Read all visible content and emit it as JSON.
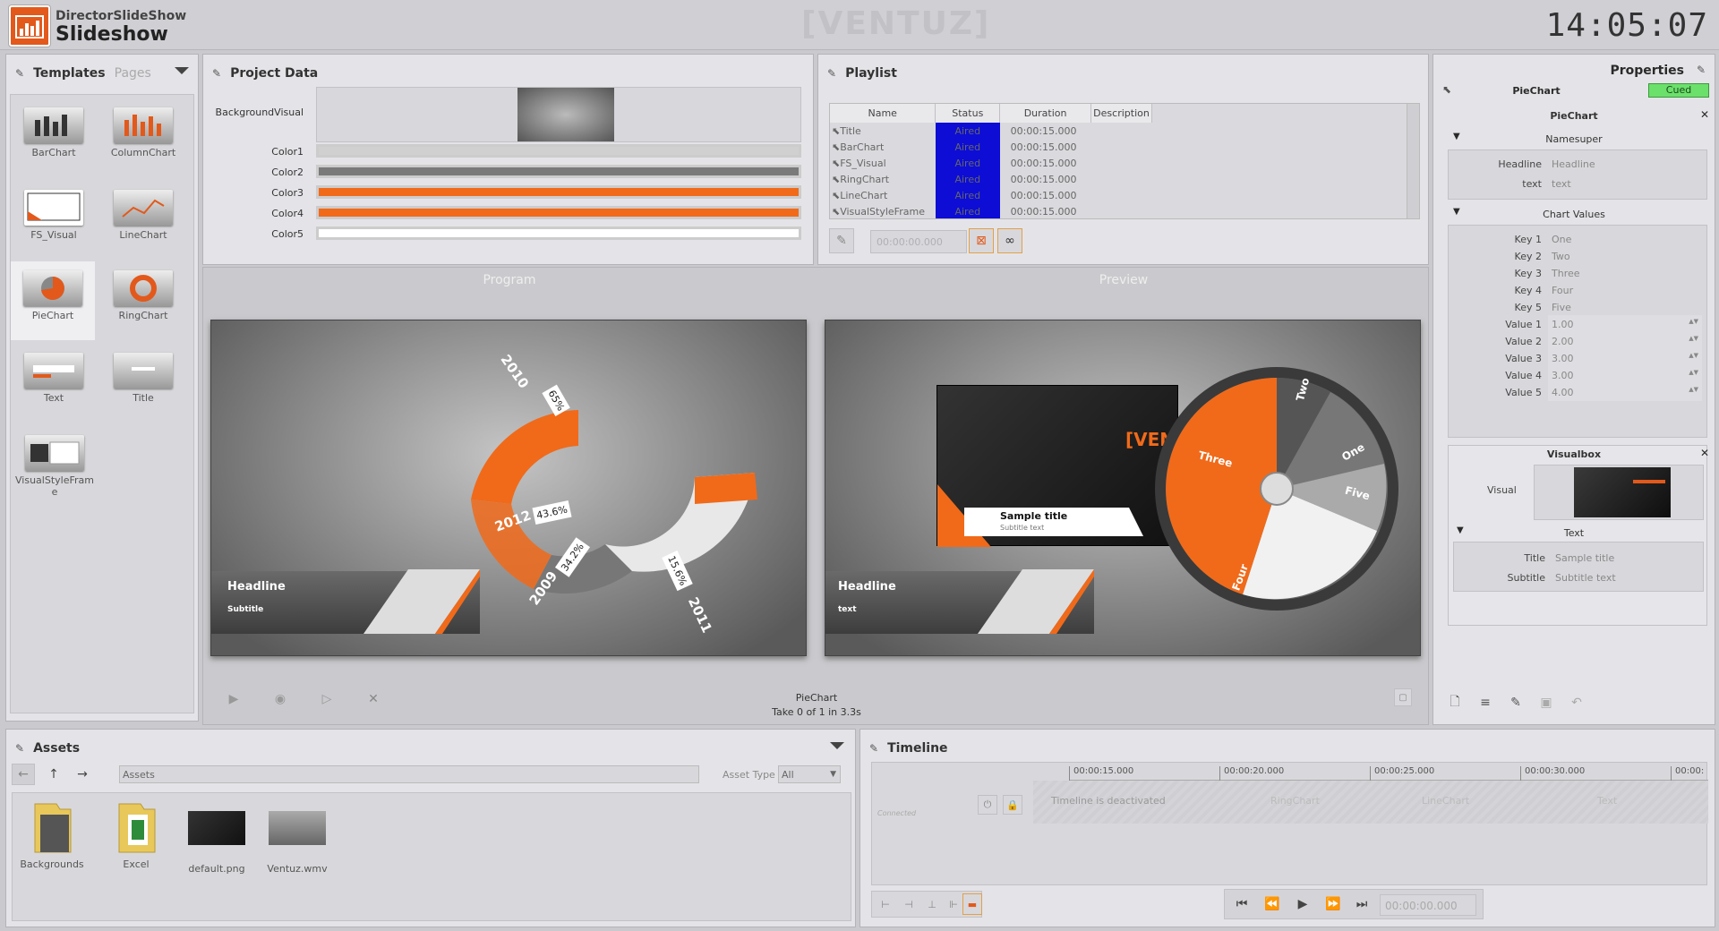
{
  "app": {
    "brand": "DirectorSlideShow",
    "title": "Slideshow",
    "clock": "14:05:07",
    "watermark": "[VENTUZ]"
  },
  "templates": {
    "tab_active": "Templates",
    "tab_inactive": "Pages",
    "items": [
      "BarChart",
      "ColumnChart",
      "FS_Visual",
      "LineChart",
      "PieChart",
      "RingChart",
      "Text",
      "Title",
      "VisualStyleFrame"
    ]
  },
  "project": {
    "title": "Project Data",
    "background_label": "BackgroundVisual",
    "colors": [
      {
        "label": "Color1",
        "value": "#d0d0d0"
      },
      {
        "label": "Color2",
        "value": "#7a7a7a"
      },
      {
        "label": "Color3",
        "value": "#f06a1a"
      },
      {
        "label": "Color4",
        "value": "#f06a1a"
      },
      {
        "label": "Color5",
        "value": "#ffffff"
      }
    ]
  },
  "playlist": {
    "title": "Playlist",
    "columns": [
      "Name",
      "Status",
      "Duration",
      "Description"
    ],
    "rows": [
      {
        "name": "Title",
        "status": "Aired",
        "duration": "00:00:15.000"
      },
      {
        "name": "BarChart",
        "status": "Aired",
        "duration": "00:00:15.000"
      },
      {
        "name": "FS_Visual",
        "status": "Aired",
        "duration": "00:00:15.000"
      },
      {
        "name": "RingChart",
        "status": "Aired",
        "duration": "00:00:15.000"
      },
      {
        "name": "LineChart",
        "status": "Aired",
        "duration": "00:00:15.000"
      },
      {
        "name": "VisualStyleFrame",
        "status": "Aired",
        "duration": "00:00:15.000"
      }
    ],
    "time_field": "00:00:00.000"
  },
  "program": {
    "label": "Program",
    "headline": "Headline",
    "subtitle": "Subtitle",
    "ring": [
      {
        "year": "2010",
        "pct": "65%"
      },
      {
        "year": "2012",
        "pct": "43.6%"
      },
      {
        "year": "2009",
        "pct": "34.2%"
      },
      {
        "year": "2011",
        "pct": "15.6%"
      }
    ],
    "status_name": "PieChart",
    "status_take": "Take 0 of 1 in 3.3s"
  },
  "preview": {
    "label": "Preview",
    "headline": "Headline",
    "text": "text",
    "sample_title": "Sample title",
    "sample_sub": "Subtitle text",
    "venz": "[VEN",
    "slices": [
      "Two",
      "One",
      "Five",
      "Four",
      "Three"
    ]
  },
  "properties": {
    "title": "Properties",
    "template": "PieChart",
    "state": "Cued",
    "section": "PieChart",
    "namesuper": {
      "label": "Namesuper",
      "fields": [
        {
          "k": "Headline",
          "v": "Headline"
        },
        {
          "k": "text",
          "v": "text"
        }
      ]
    },
    "chart": {
      "label": "Chart Values",
      "fields": [
        {
          "k": "Key 1",
          "v": "One"
        },
        {
          "k": "Key 2",
          "v": "Two"
        },
        {
          "k": "Key 3",
          "v": "Three"
        },
        {
          "k": "Key 4",
          "v": "Four"
        },
        {
          "k": "Key 5",
          "v": "Five"
        },
        {
          "k": "Value 1",
          "v": "1.00"
        },
        {
          "k": "Value 2",
          "v": "2.00"
        },
        {
          "k": "Value 3",
          "v": "3.00"
        },
        {
          "k": "Value 4",
          "v": "3.00"
        },
        {
          "k": "Value 5",
          "v": "4.00"
        }
      ]
    },
    "visualbox": {
      "label": "Visualbox",
      "visual_label": "Visual"
    },
    "text": {
      "label": "Text",
      "fields": [
        {
          "k": "Title",
          "v": "Sample title"
        },
        {
          "k": "Subtitle",
          "v": "Subtitle text"
        }
      ]
    }
  },
  "assets": {
    "title": "Assets",
    "path": "Assets",
    "type_label": "Asset Type",
    "type_value": "All",
    "items": [
      "Backgrounds",
      "Excel",
      "default.png",
      "Ventuz.wmv"
    ]
  },
  "timeline": {
    "title": "Timeline",
    "ticks": [
      "00:00:15.000",
      "00:00:20.000",
      "00:00:25.000",
      "00:00:30.000",
      "00:00:"
    ],
    "deactivated": "Timeline is deactivated",
    "connected": "Connected",
    "ghost": [
      "RingChart",
      "LineChart",
      "Text"
    ],
    "time_field": "00:00:00.000"
  }
}
